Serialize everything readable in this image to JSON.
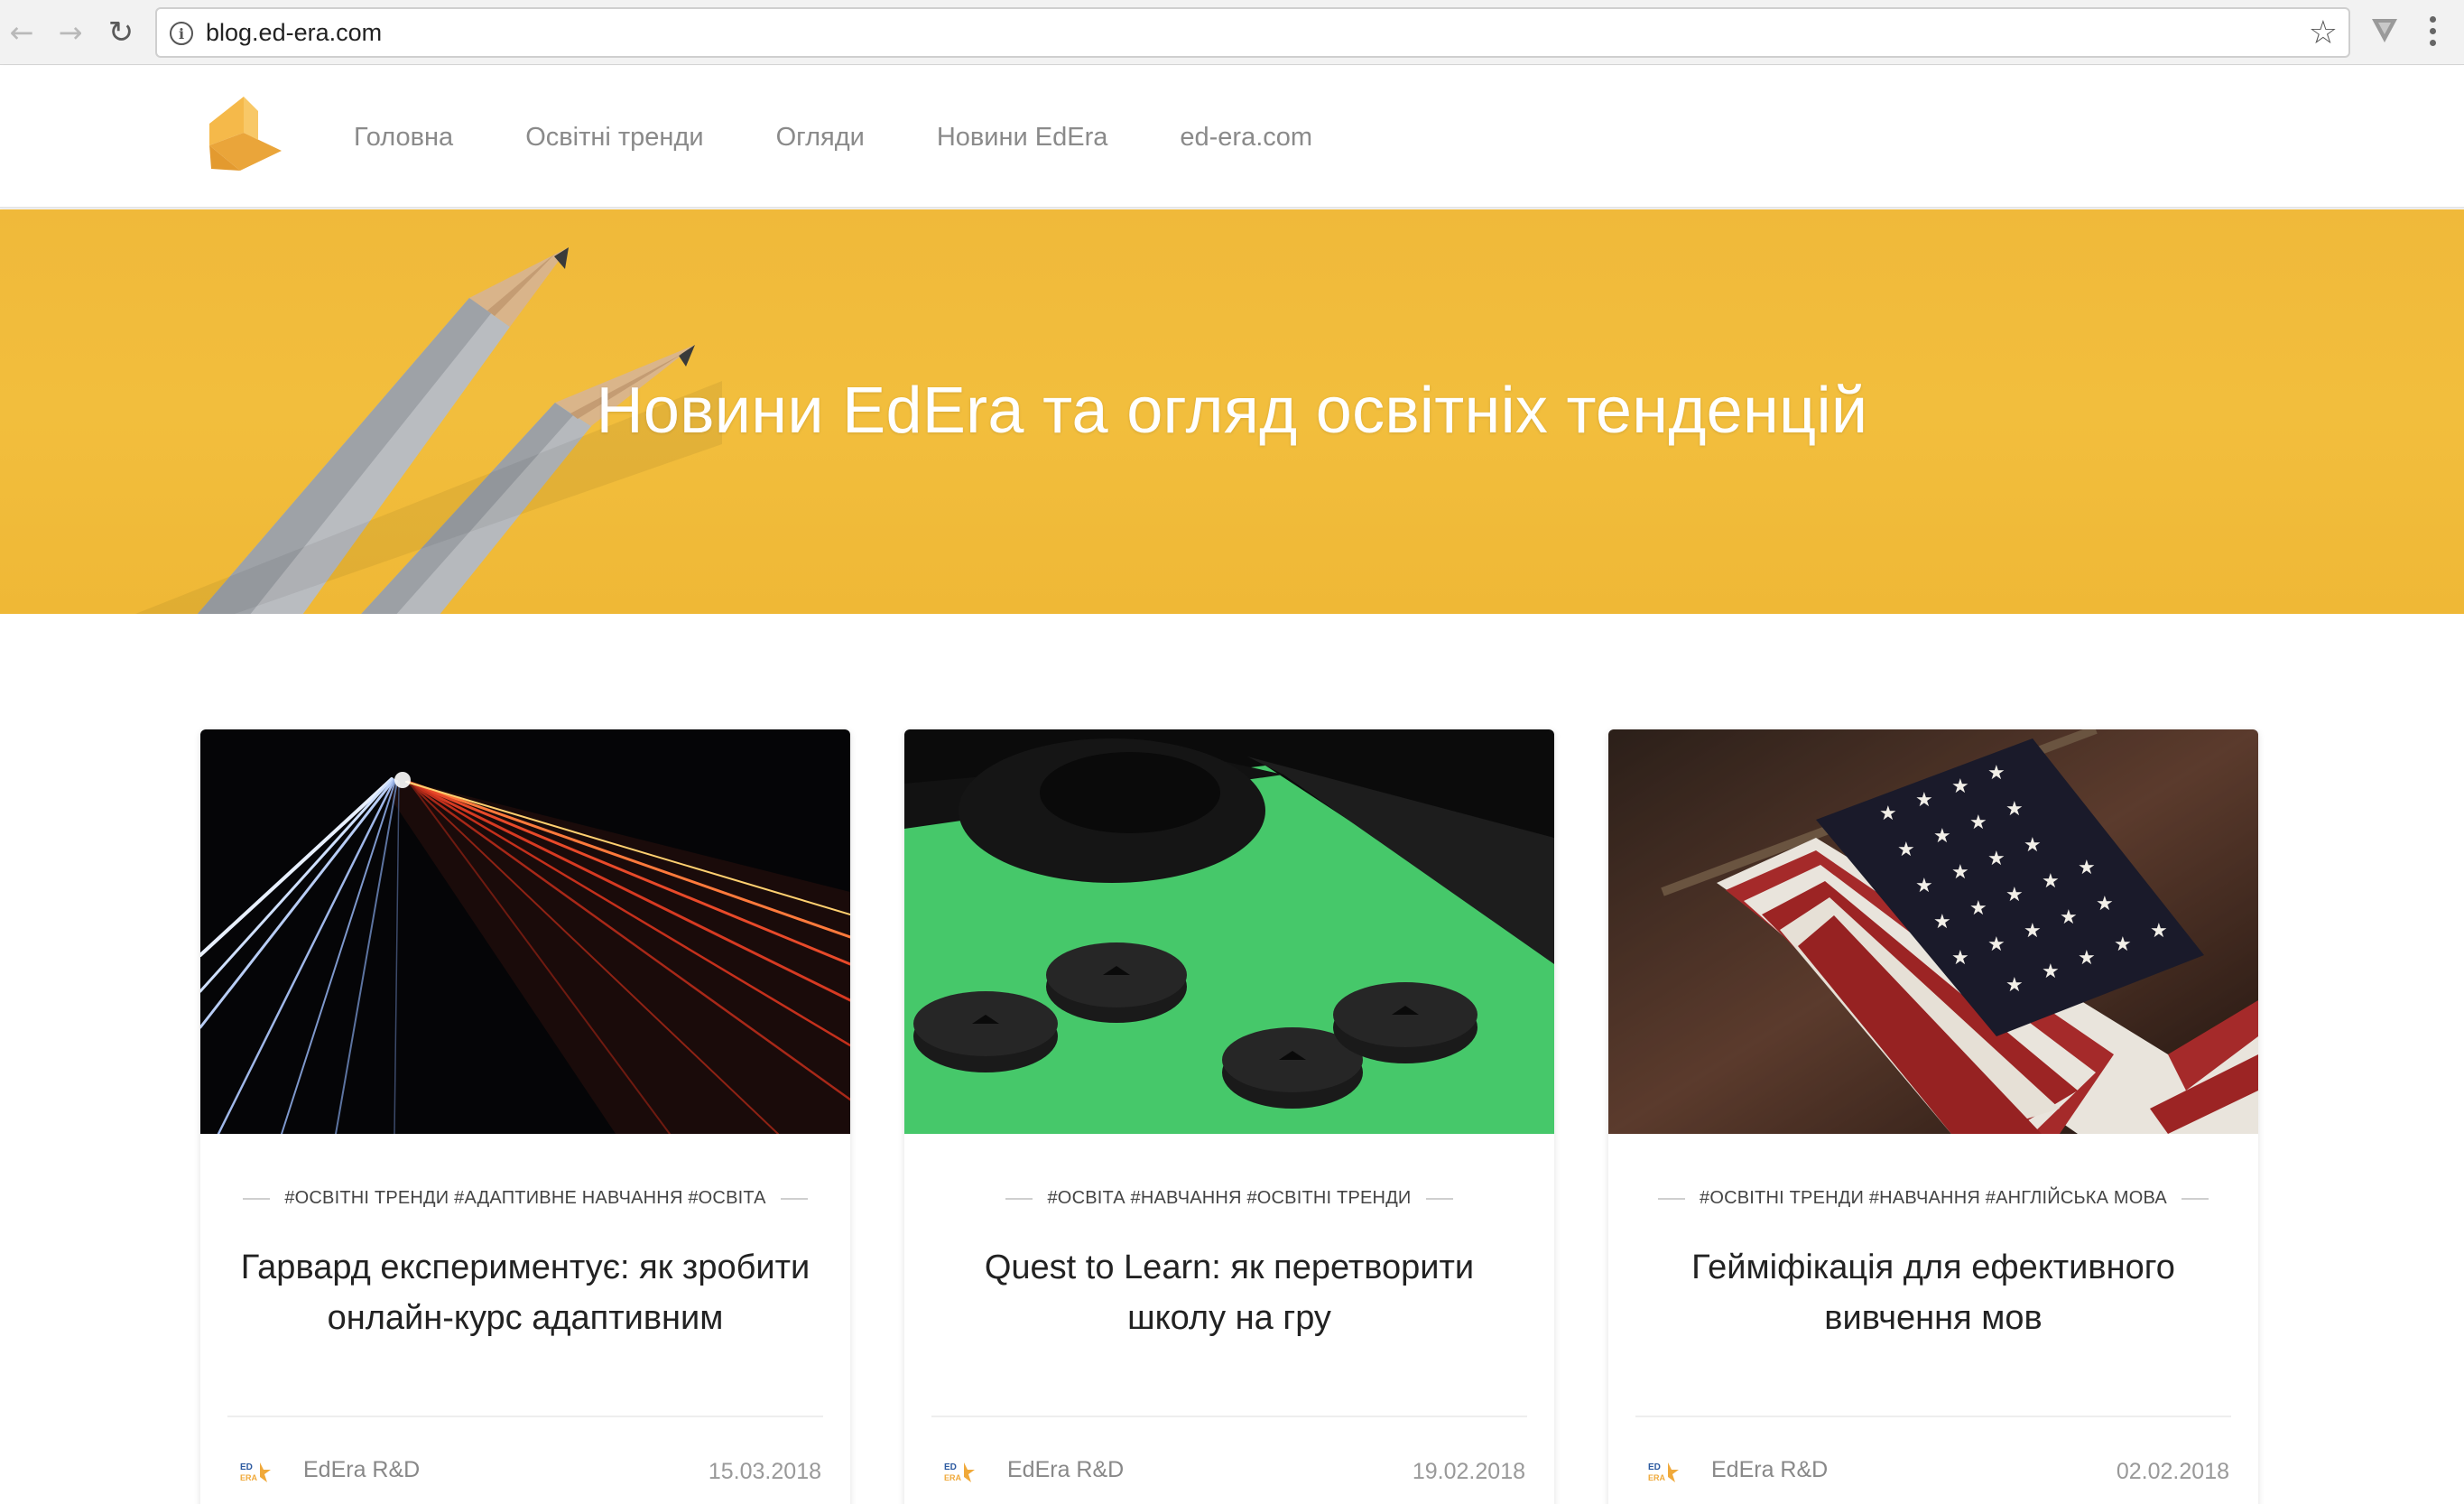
{
  "browser": {
    "url": "blog.ed-era.com",
    "back_icon": "←",
    "forward_icon": "→",
    "reload_icon": "↻",
    "info_icon": "i",
    "bookmark_icon": "☆"
  },
  "site": {
    "nav": [
      {
        "label": "Головна"
      },
      {
        "label": "Освітні тренди"
      },
      {
        "label": "Огляди"
      },
      {
        "label": "Новини EdEra"
      },
      {
        "label": "ed-era.com"
      }
    ]
  },
  "hero": {
    "title": "Новини EdEra та огляд освітніх тенденцій"
  },
  "colors": {
    "accent_yellow": "#f2be3d",
    "logo_orange": "#f0a93a"
  },
  "posts": [
    {
      "tags": "#ОСВІТНІ ТРЕНДИ #АДАПТИВНЕ НАВЧАННЯ #ОСВІТА",
      "title_line1": "Гарвард експериментує: як зробити",
      "title_line2": "онлайн-курс адаптивним",
      "author": "EdEra R&D",
      "date": "15.03.2018",
      "image": "highway-night-light-trails"
    },
    {
      "tags": "#ОСВІТА #НАВЧАННЯ #ОСВІТНІ ТРЕНДИ",
      "title_line1": "Quest to Learn: як перетворити",
      "title_line2": "школу на гру",
      "author": "EdEra R&D",
      "date": "19.02.2018",
      "image": "game-controller-buttons"
    },
    {
      "tags": "#ОСВІТНІ ТРЕНДИ #НАВЧАННЯ #АНГЛІЙСЬКА МОВА",
      "title_line1": "Гейміфікація для ефективного",
      "title_line2": "вивчення мов",
      "author": "EdEra R&D",
      "date": "02.02.2018",
      "image": "us-flag"
    }
  ]
}
